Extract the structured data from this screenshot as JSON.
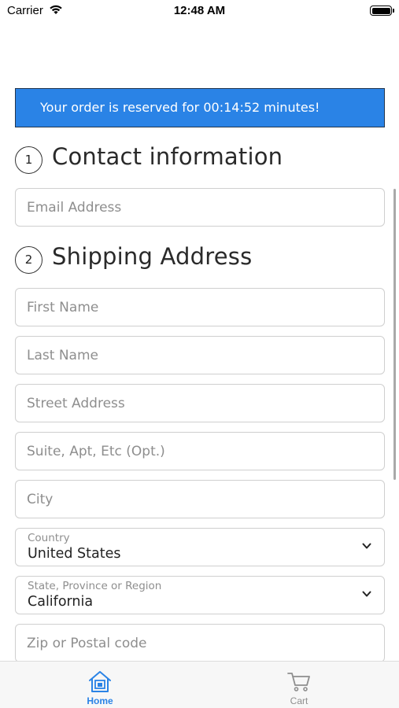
{
  "status_bar": {
    "carrier": "Carrier",
    "time": "12:48 AM"
  },
  "banner": {
    "text": "Your order is reserved for 00:14:52 minutes!"
  },
  "sections": {
    "contact": {
      "step": "1",
      "title": "Contact information"
    },
    "shipping": {
      "step": "2",
      "title": "Shipping Address"
    }
  },
  "fields": {
    "email": {
      "placeholder": "Email Address",
      "value": ""
    },
    "first_name": {
      "placeholder": "First Name",
      "value": ""
    },
    "last_name": {
      "placeholder": "Last Name",
      "value": ""
    },
    "street": {
      "placeholder": "Street Address",
      "value": ""
    },
    "suite": {
      "placeholder": "Suite, Apt, Etc (Opt.)",
      "value": ""
    },
    "city": {
      "placeholder": "City",
      "value": ""
    },
    "country": {
      "label": "Country",
      "value": "United States"
    },
    "state": {
      "label": "State, Province or Region",
      "value": "California"
    },
    "zip": {
      "placeholder": "Zip or Postal code",
      "value": ""
    }
  },
  "tab_bar": {
    "home": {
      "label": "Home",
      "icon": "home-icon",
      "active": true
    },
    "cart": {
      "label": "Cart",
      "icon": "cart-icon",
      "active": false
    }
  },
  "colors": {
    "accent": "#2a83e6",
    "banner_border": "#23364d",
    "field_border": "#cfcfcf",
    "placeholder": "#8e8e8e",
    "inactive_tab": "#8e8e8e"
  }
}
